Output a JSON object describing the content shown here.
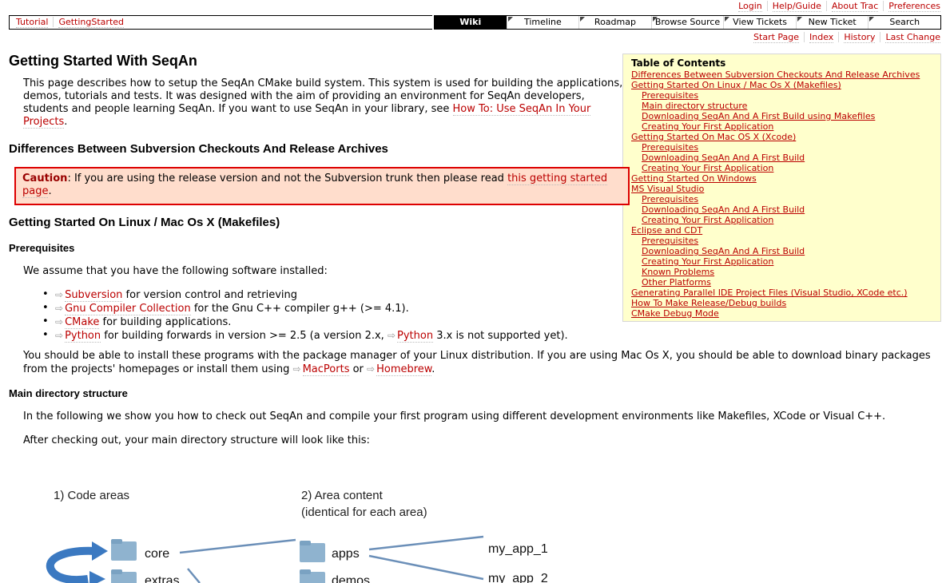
{
  "metanav": [
    "Login",
    "Help/Guide",
    "About Trac",
    "Preferences"
  ],
  "ctxtnav": [
    "Tutorial",
    "GettingStarted"
  ],
  "mainnav": [
    {
      "label": "Wiki",
      "active": true
    },
    {
      "label": "Timeline",
      "active": false
    },
    {
      "label": "Roadmap",
      "active": false
    },
    {
      "label": "Browse Source",
      "active": false
    },
    {
      "label": "View Tickets",
      "active": false
    },
    {
      "label": "New Ticket",
      "active": false
    },
    {
      "label": "Search",
      "active": false
    }
  ],
  "pagenav": [
    "Start Page",
    "Index",
    "History",
    "Last Change"
  ],
  "page": {
    "title": "Getting Started With SeqAn",
    "intro": "This page describes how to setup the SeqAn CMake build system. This system is used for building the applications, demos, tutorials and tests. It was designed with the aim of providing an environment for SeqAn developers, students and people learning SeqAn. If you want to use SeqAn in your library, see ",
    "intro_link": "How To: Use SeqAn In Your Projects",
    "h_diff": "Differences Between Subversion Checkouts And Release Archives",
    "caution_label": "Caution",
    "caution_text": ": If you are using the release version and not the Subversion trunk then please read ",
    "caution_link": "this getting started page",
    "h_linux": "Getting Started On Linux / Mac Os X (Makefiles)",
    "h_prereq": "Prerequisites",
    "prereq_intro": "We assume that you have the following software installed:",
    "software": [
      {
        "link": "Subversion",
        "text": " for version control and retrieving"
      },
      {
        "link": "Gnu Compiler Collection",
        "text": " for the Gnu C++ compiler g++ (>= 4.1)."
      },
      {
        "link": "CMake",
        "text": " for building applications."
      },
      {
        "link": "Python",
        "text": " for building forwards in version >= 2.5 (a version 2.x, ",
        "link2": "Python",
        "text2": " 3.x is not supported yet)."
      }
    ],
    "install_text": "You should be able to install these programs with the package manager of your Linux distribution. If you are using Mac Os X, you should be able to download binary packages from the projects' homepages or install them using ",
    "install_link1": "MacPorts",
    "install_or": " or ",
    "install_link2": "Homebrew",
    "h_maindir": "Main directory structure",
    "maindir_text1": "In the following we show you how to check out SeqAn and compile your first program using different development environments like Makefiles, XCode or Visual C++.",
    "maindir_text2": "After checking out, your main directory structure will look like this:"
  },
  "toc": {
    "title": "Table of Contents",
    "items": [
      {
        "label": "Differences Between Subversion Checkouts And Release Archives",
        "level": 1
      },
      {
        "label": "Getting Started On Linux / Mac Os X (Makefiles)",
        "level": 1
      },
      {
        "label": "Prerequisites",
        "level": 2
      },
      {
        "label": "Main directory structure",
        "level": 2
      },
      {
        "label": "Downloading SeqAn And A First Build using Makefiles",
        "level": 2
      },
      {
        "label": "Creating Your First Application",
        "level": 2
      },
      {
        "label": "Getting Started On Mac OS X (Xcode)",
        "level": 1
      },
      {
        "label": "Prerequisites",
        "level": 2
      },
      {
        "label": "Downloading SeqAn And A First Build",
        "level": 2
      },
      {
        "label": "Creating Your First Application",
        "level": 2
      },
      {
        "label": "Getting Started On Windows",
        "level": 1
      },
      {
        "label": "MS Visual Studio",
        "level": 1
      },
      {
        "label": "Prerequisites",
        "level": 2
      },
      {
        "label": "Downloading SeqAn And A First Build",
        "level": 2
      },
      {
        "label": "Creating Your First Application",
        "level": 2
      },
      {
        "label": "Eclipse and CDT",
        "level": 1
      },
      {
        "label": "Prerequisites",
        "level": 2
      },
      {
        "label": "Downloading SeqAn And A First Build",
        "level": 2
      },
      {
        "label": "Creating Your First Application",
        "level": 2
      },
      {
        "label": "Known Problems",
        "level": 2
      },
      {
        "label": "Other Platforms",
        "level": 2
      },
      {
        "label": "Generating Parallel IDE Project Files (Visual Studio, XCode etc.)",
        "level": 1
      },
      {
        "label": "How To Make Release/Debug builds",
        "level": 1
      },
      {
        "label": "CMake Debug Mode",
        "level": 1
      }
    ]
  },
  "diagram": {
    "col1_title": "1) Code areas",
    "col2_title_line1": "2) Area content",
    "col2_title_line2": "(identical for each area)",
    "areas": [
      "core",
      "extras"
    ],
    "content": [
      "apps",
      "demos"
    ],
    "apps": [
      "my_app_1",
      "my_app_2"
    ]
  },
  "colors": {
    "link": "#bb0000",
    "toc_bg": "#ffffcc",
    "caution_bg": "#ffddcc",
    "caution_border": "#dd0000"
  }
}
